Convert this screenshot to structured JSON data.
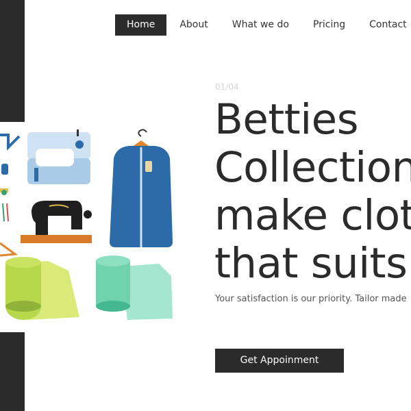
{
  "nav": {
    "items": [
      {
        "label": "Home",
        "active": true
      },
      {
        "label": "About"
      },
      {
        "label": "What we do"
      },
      {
        "label": "Pricing"
      },
      {
        "label": "Contact"
      }
    ]
  },
  "hero": {
    "counter": "01/04",
    "title": "Betties\nCollection\nmake cloth\nthat suits",
    "subtitle": "Your satisfaction is our priority. Tailor made",
    "cta_label": "Get Appoinment"
  },
  "colors": {
    "dark": "#2b2b2b",
    "sewing_machine": "#a9cbe8",
    "garment_bag": "#2c6aa8",
    "fabric_green": "#b7d84a",
    "fabric_teal": "#6fd3b0"
  },
  "icons": [
    "sewing-machine-icon",
    "vintage-sewing-machine-icon",
    "garment-bag-icon",
    "fabric-roll-green-icon",
    "fabric-roll-teal-icon",
    "hanger-icon",
    "thread-spools-icon"
  ]
}
